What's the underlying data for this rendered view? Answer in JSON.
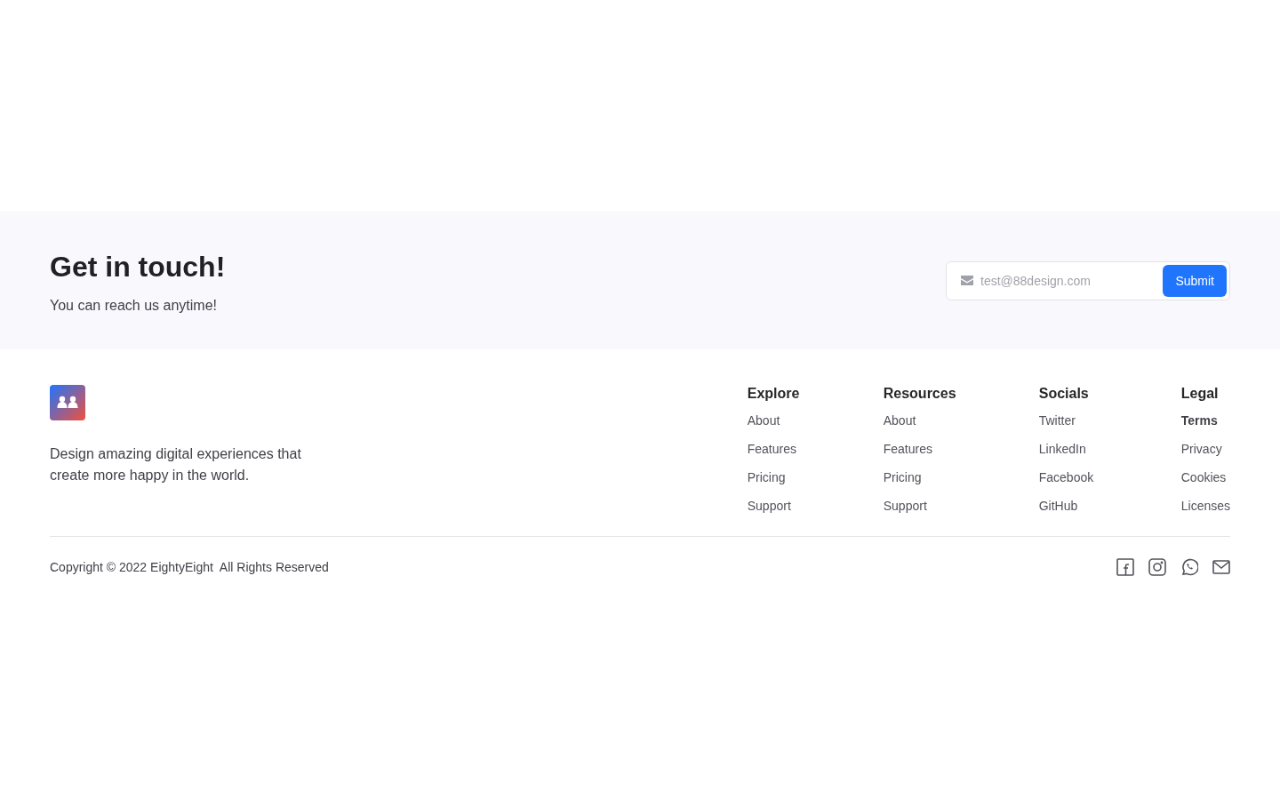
{
  "contact": {
    "title": "Get in touch!",
    "subtitle": "You can reach us anytime!",
    "email_field": {
      "placeholder": "test@88design.com"
    },
    "submit": "Submit"
  },
  "footer": {
    "tagline": "Design amazing digital experiences that create more happy in the world.",
    "columns": [
      {
        "heading": "Explore",
        "links": [
          {
            "label": "About",
            "selected": false
          },
          {
            "label": "Features",
            "selected": false
          },
          {
            "label": "Pricing",
            "selected": false
          },
          {
            "label": "Support",
            "selected": false
          }
        ]
      },
      {
        "heading": "Resources",
        "links": [
          {
            "label": "About",
            "selected": false
          },
          {
            "label": "Features",
            "selected": false
          },
          {
            "label": "Pricing",
            "selected": false
          },
          {
            "label": "Support",
            "selected": false
          }
        ]
      },
      {
        "heading": "Socials",
        "links": [
          {
            "label": "Twitter",
            "selected": false
          },
          {
            "label": "LinkedIn",
            "selected": false
          },
          {
            "label": "Facebook",
            "selected": false
          },
          {
            "label": "GitHub",
            "selected": false
          }
        ]
      },
      {
        "heading": "Legal",
        "links": [
          {
            "label": "Terms",
            "selected": true
          },
          {
            "label": "Privacy",
            "selected": false
          },
          {
            "label": "Cookies",
            "selected": false
          },
          {
            "label": "Licenses",
            "selected": false
          }
        ]
      }
    ],
    "copyright": "Copyright © 2022 EightyEight  All Rights Reserved"
  }
}
